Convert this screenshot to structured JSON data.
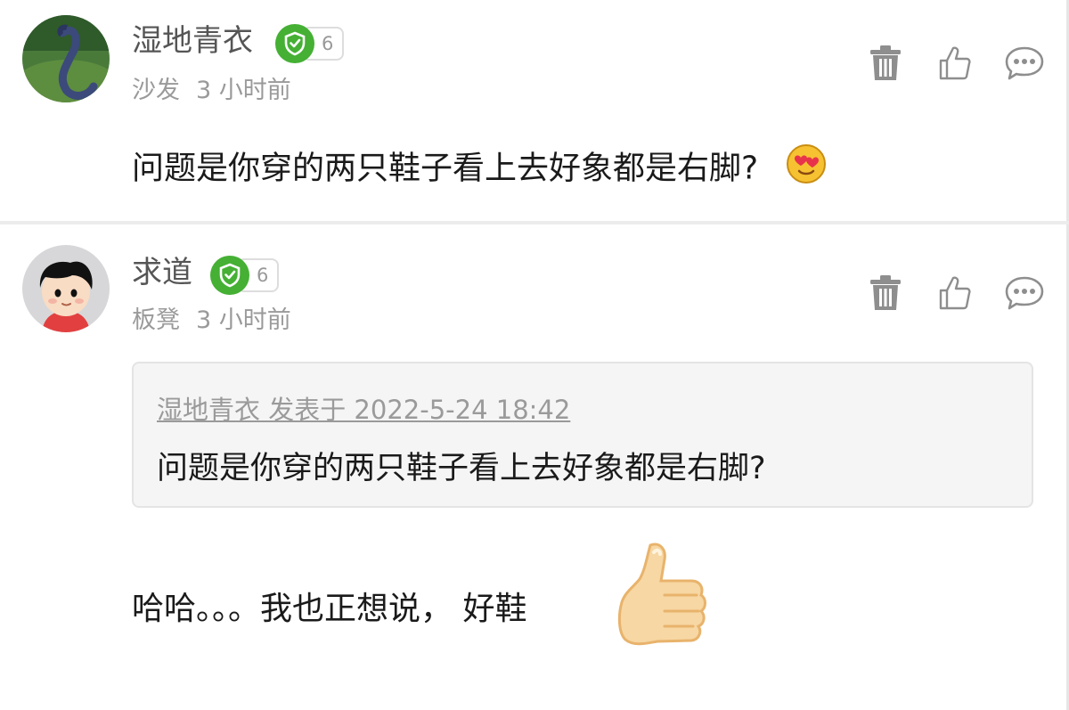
{
  "comments": [
    {
      "user": "湿地青衣",
      "level": "6",
      "floor": "沙发",
      "time": "3 小时前",
      "text": "问题是你穿的两只鞋子看上去好象都是右脚?",
      "emoji": "heart-eyes-emoji"
    },
    {
      "user": "求道",
      "level": "6",
      "floor": "板凳",
      "time": "3 小时前",
      "quote": {
        "meta": "湿地青衣 发表于 2022-5-24 18:42",
        "text": "问题是你穿的两只鞋子看上去好象都是右脚?"
      },
      "text": "哈哈。。。我也正想说， 好鞋",
      "emoji": "thumbs-up-emoji"
    }
  ],
  "icons": {
    "delete": "trash-icon",
    "like": "thumb-up-icon",
    "reply": "chat-bubble-icon",
    "badge": "shield-check-icon"
  },
  "colors": {
    "badge_green": "#45b034",
    "meta_gray": "#9a9a9a",
    "quote_bg": "#f5f5f5"
  }
}
